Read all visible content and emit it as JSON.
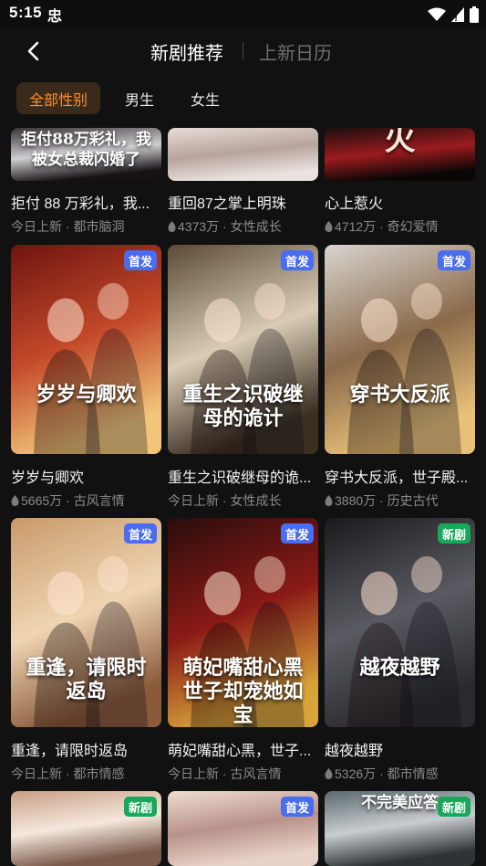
{
  "status_bar": {
    "time": "5:15",
    "notification": "忠"
  },
  "nav": {
    "active_tab": "新剧推荐",
    "other_tab": "上新日历"
  },
  "filters": [
    "全部性别",
    "男生",
    "女生"
  ],
  "colors": {
    "accent": "#ff8f2a",
    "badge_first": "#4a6cf0",
    "badge_new": "#17a85a",
    "background": "#111111"
  },
  "rows": [
    [
      {
        "title": "拒付 88 万彩礼，我...",
        "meta": "今日上新 · 都市脑洞",
        "hot": false,
        "poster_text": "拒付88万彩礼，我被女总裁闪婚了",
        "badge": ""
      },
      {
        "title": "重回87之掌上明珠",
        "meta": "4373万 · 女性成长",
        "hot": true,
        "poster_text": "",
        "badge": ""
      },
      {
        "title": "心上惹火",
        "meta": "4712万 · 奇幻爱情",
        "hot": true,
        "poster_text": "火",
        "badge": ""
      }
    ],
    [
      {
        "title": "岁岁与卿欢",
        "meta": "5665万 · 古风言情",
        "hot": true,
        "poster_text": "岁岁与卿欢",
        "badge": "首发"
      },
      {
        "title": "重生之识破继母的诡...",
        "meta": "今日上新 · 女性成长",
        "hot": false,
        "poster_text": "重生之识破继母的诡计",
        "badge": "首发"
      },
      {
        "title": "穿书大反派，世子殿...",
        "meta": "3880万 · 历史古代",
        "hot": true,
        "poster_text": "穿书大反派",
        "badge": "首发"
      }
    ],
    [
      {
        "title": "重逢，请限时返岛",
        "meta": "今日上新 · 都市情感",
        "hot": false,
        "poster_text": "重逢，请限时返岛",
        "badge": "首发"
      },
      {
        "title": "萌妃嘴甜心黑，世子...",
        "meta": "今日上新 · 古风言情",
        "hot": false,
        "poster_text": "萌妃嘴甜心黑 世子却宠她如宝",
        "badge": "首发"
      },
      {
        "title": "越夜越野",
        "meta": "5326万 · 都市情感",
        "hot": true,
        "poster_text": "越夜越野",
        "badge": "新剧"
      }
    ],
    [
      {
        "title": "",
        "meta": "",
        "hot": false,
        "poster_text": "",
        "badge": "新剧"
      },
      {
        "title": "",
        "meta": "",
        "hot": false,
        "poster_text": "",
        "badge": "首发"
      },
      {
        "title": "",
        "meta": "",
        "hot": false,
        "poster_text": "不完美应答",
        "badge": "新剧"
      }
    ]
  ]
}
